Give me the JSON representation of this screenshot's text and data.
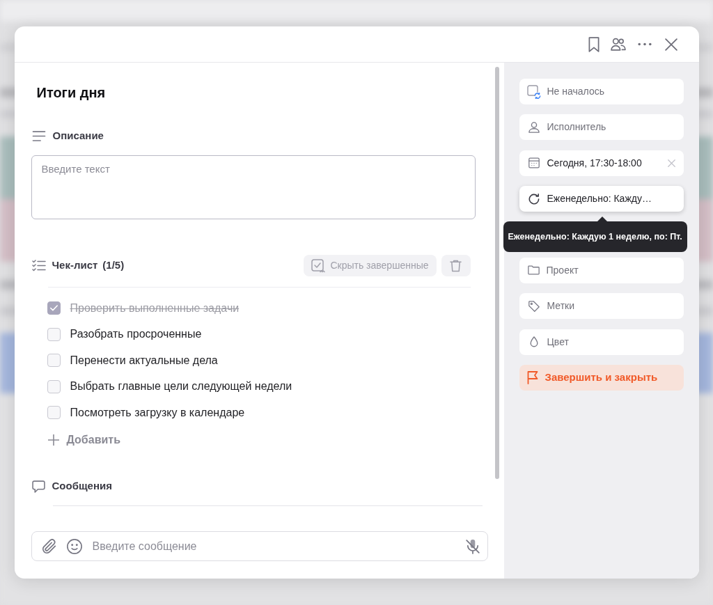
{
  "dialog": {
    "title": "Итоги дня"
  },
  "description": {
    "label": "Описание",
    "placeholder": "Введите текст"
  },
  "checklist": {
    "label": "Чек-лист",
    "count": "(1/5)",
    "hide_completed": "Скрыть завершенные",
    "items": [
      {
        "text": "Проверить выполненные задачи",
        "checked": true
      },
      {
        "text": "Разобрать просроченные",
        "checked": false
      },
      {
        "text": "Перенести актуальные дела",
        "checked": false
      },
      {
        "text": "Выбрать главные цели следующей недели",
        "checked": false
      },
      {
        "text": "Посмотреть загрузку в календаре",
        "checked": false
      }
    ],
    "add_label": "Добавить"
  },
  "messages": {
    "label": "Сообщения",
    "placeholder": "Введите сообщение"
  },
  "properties": [
    {
      "kind": "status",
      "label": "Не началось",
      "set": false,
      "hovered": false
    },
    {
      "kind": "assignee",
      "label": "Исполнитель",
      "set": false,
      "hovered": false
    },
    {
      "kind": "date",
      "label": "Сегодня, 17:30-18:00",
      "set": true,
      "hovered": false
    },
    {
      "kind": "repeat",
      "label": "Еженедельно: Кажду…",
      "set": true,
      "hovered": true,
      "tooltip": "Еженедельно: Каждую 1 неделю, по: Пт."
    },
    {
      "kind": "project",
      "label": "Проект",
      "set": false,
      "hovered": false
    },
    {
      "kind": "tags",
      "label": "Метки",
      "set": false,
      "hovered": false
    },
    {
      "kind": "color",
      "label": "Цвет",
      "set": false,
      "hovered": false
    }
  ],
  "finish_button": "Завершить и закрыть"
}
